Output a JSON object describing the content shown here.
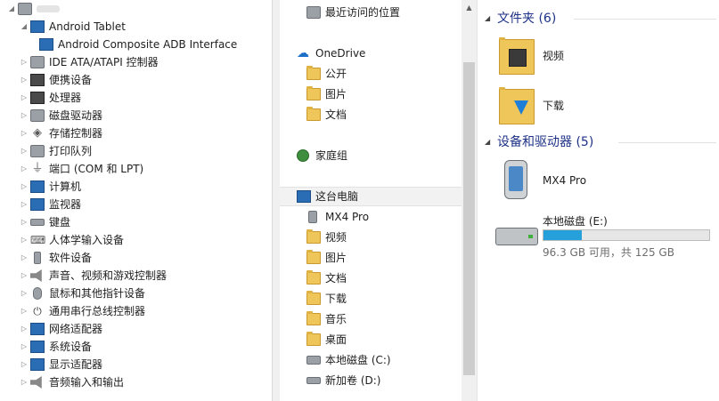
{
  "device_tree": {
    "items": [
      {
        "label": "",
        "icon": "computer-icon",
        "expanded": true
      },
      {
        "label": "Android Tablet",
        "icon": "monitor-icon",
        "expanded": true
      },
      {
        "label": "Android Composite ADB Interface",
        "icon": "monitor-icon"
      },
      {
        "label": "IDE ATA/ATAPI 控制器",
        "icon": "ide-controller-icon"
      },
      {
        "label": "便携设备",
        "icon": "portable-device-icon"
      },
      {
        "label": "处理器",
        "icon": "processor-icon"
      },
      {
        "label": "磁盘驱动器",
        "icon": "disk-drive-icon"
      },
      {
        "label": "存储控制器",
        "icon": "storage-controller-icon"
      },
      {
        "label": "打印队列",
        "icon": "printer-icon"
      },
      {
        "label": "端口 (COM 和 LPT)",
        "icon": "port-icon"
      },
      {
        "label": "计算机",
        "icon": "computer-icon"
      },
      {
        "label": "监视器",
        "icon": "monitor-icon"
      },
      {
        "label": "键盘",
        "icon": "keyboard-icon"
      },
      {
        "label": "人体学输入设备",
        "icon": "hid-icon"
      },
      {
        "label": "软件设备",
        "icon": "software-device-icon"
      },
      {
        "label": "声音、视频和游戏控制器",
        "icon": "speaker-icon"
      },
      {
        "label": "鼠标和其他指针设备",
        "icon": "mouse-icon"
      },
      {
        "label": "通用串行总线控制器",
        "icon": "usb-icon"
      },
      {
        "label": "网络适配器",
        "icon": "network-adapter-icon"
      },
      {
        "label": "系统设备",
        "icon": "system-device-icon"
      },
      {
        "label": "显示适配器",
        "icon": "display-adapter-icon"
      },
      {
        "label": "音频输入和输出",
        "icon": "audio-io-icon"
      }
    ]
  },
  "nav": {
    "recent": "最近访问的位置",
    "onedrive": "OneDrive",
    "onedrive_items": [
      "公开",
      "图片",
      "文档"
    ],
    "homegroup": "家庭组",
    "this_pc": "这台电脑",
    "this_pc_items": [
      "MX4 Pro",
      "视频",
      "图片",
      "文档",
      "下载",
      "音乐",
      "桌面",
      "本地磁盘 (C:)",
      "新加卷 (D:)"
    ]
  },
  "content": {
    "folders_header": "文件夹 (6)",
    "folders": [
      "视频",
      "下载"
    ],
    "devices_header": "设备和驱动器 (5)",
    "device_name": "MX4 Pro",
    "drive_name": "本地磁盘 (E:)",
    "drive_space": "96.3 GB 可用，共 125 GB",
    "drive_used_fraction": 0.23
  },
  "colors": {
    "accent": "#26a0da",
    "header": "#1e3287",
    "folder": "#eec65a"
  }
}
